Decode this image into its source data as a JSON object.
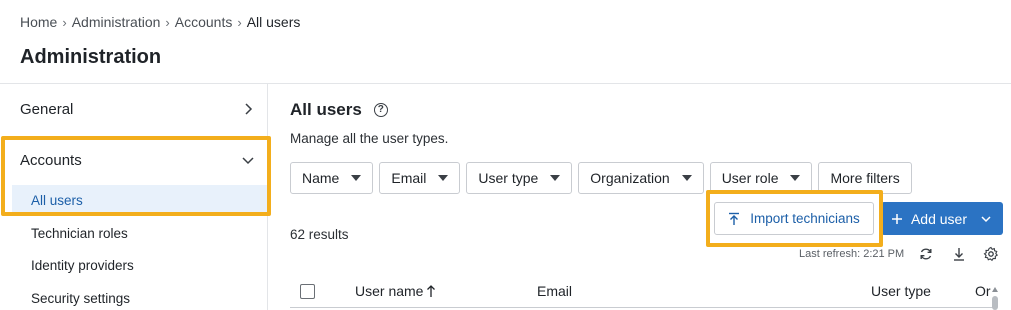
{
  "breadcrumb": {
    "items": [
      "Home",
      "Administration",
      "Accounts"
    ],
    "current": "All users"
  },
  "page_title": "Administration",
  "sidebar": {
    "sections": [
      {
        "label": "General",
        "expanded": false
      },
      {
        "label": "Accounts",
        "expanded": true
      }
    ],
    "items": [
      {
        "label": "All users",
        "active": true
      },
      {
        "label": "Technician roles",
        "active": false
      },
      {
        "label": "Identity providers",
        "active": false
      },
      {
        "label": "Security settings",
        "active": false
      }
    ]
  },
  "main": {
    "title": "All users",
    "subtitle": "Manage all the user types.",
    "filters": [
      "Name",
      "Email",
      "User type",
      "Organization",
      "User role"
    ],
    "more_filters": "More filters",
    "results": "62 results",
    "import_label": "Import technicians",
    "add_label": "Add user",
    "last_refresh": "Last refresh: 2:21 PM",
    "table_headers": [
      "User name",
      "Email",
      "User type",
      "Or"
    ]
  },
  "colors": {
    "accent": "#2b73c3",
    "highlight": "#f3ae1c",
    "active_bg": "#e8f1fb"
  }
}
